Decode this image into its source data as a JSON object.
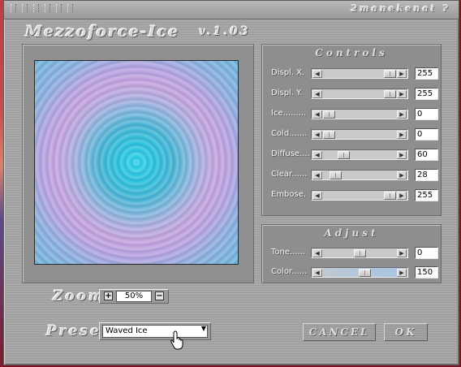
{
  "window": {
    "credit": "2manekenat ?",
    "app_title": "Mezzoforce-Ice",
    "version": "v.1.03"
  },
  "controls": {
    "title": "Controls",
    "rows": [
      {
        "label": "Displ. X.",
        "value": "255",
        "level": 1.0
      },
      {
        "label": "Displ. Y.",
        "value": "255",
        "level": 1.0
      },
      {
        "label": "Ice.........",
        "value": "0",
        "level": 0.0
      },
      {
        "label": "Cold.......",
        "value": "0",
        "level": 0.0
      },
      {
        "label": "Diffuse....",
        "value": "60",
        "level": 0.235
      },
      {
        "label": "Clear......",
        "value": "28",
        "level": 0.11
      },
      {
        "label": "Embose.",
        "value": "255",
        "level": 1.0
      }
    ]
  },
  "adjust": {
    "title": "Adjust",
    "rows": [
      {
        "label": "Tone......",
        "value": "0",
        "level": 0.5
      },
      {
        "label": "Color......",
        "value": "150",
        "level": 0.59
      }
    ]
  },
  "zoom": {
    "label": "Zoom",
    "value": "50%",
    "plus": "+",
    "minus": "−"
  },
  "preset": {
    "label": "Preset",
    "selected": "Waved Ice"
  },
  "buttons": {
    "cancel": "CANCEL",
    "ok": "OK"
  }
}
